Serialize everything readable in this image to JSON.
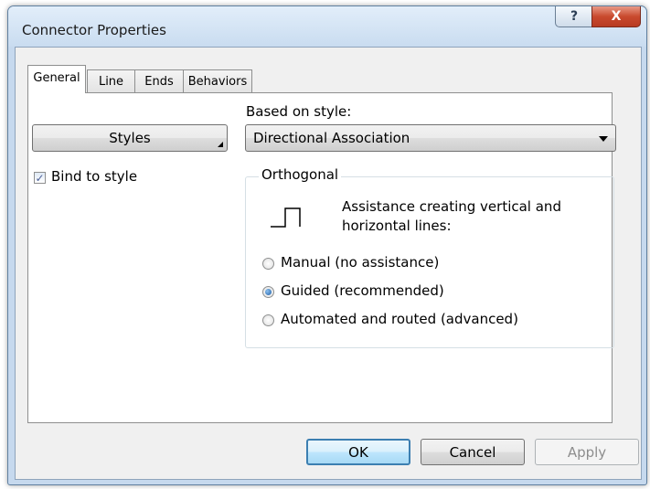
{
  "window": {
    "title": "Connector Properties",
    "help_label": "?",
    "close_label": "X"
  },
  "tabs": [
    {
      "label": "General",
      "active": true
    },
    {
      "label": "Line",
      "active": false
    },
    {
      "label": "Ends",
      "active": false
    },
    {
      "label": "Behaviors",
      "active": false
    }
  ],
  "general": {
    "styles_button": "Styles",
    "based_on_label": "Based on style:",
    "based_on_value": "Directional Association",
    "bind_to_style_label": "Bind to style",
    "bind_to_style_checked": true,
    "orthogonal": {
      "legend": "Orthogonal",
      "description": [
        "Assistance creating vertical and",
        "horizontal lines:"
      ],
      "options": [
        {
          "label": "Manual (no assistance)",
          "selected": false
        },
        {
          "label": "Guided (recommended)",
          "selected": true
        },
        {
          "label": "Automated and routed (advanced)",
          "selected": false
        }
      ]
    }
  },
  "footer": {
    "ok_label": "OK",
    "cancel_label": "Cancel",
    "apply_label": "Apply",
    "apply_enabled": false
  },
  "colors": {
    "frame": "#c6d9ee",
    "close_button": "#c94a2e",
    "ok_border": "#3c7fb1",
    "disabled_text": "#8d8d8d"
  },
  "icons": {
    "help": "question-mark-icon",
    "close": "close-icon",
    "orthogonal": "orthogonal-line-icon",
    "dropdown": "chevron-down-icon"
  }
}
